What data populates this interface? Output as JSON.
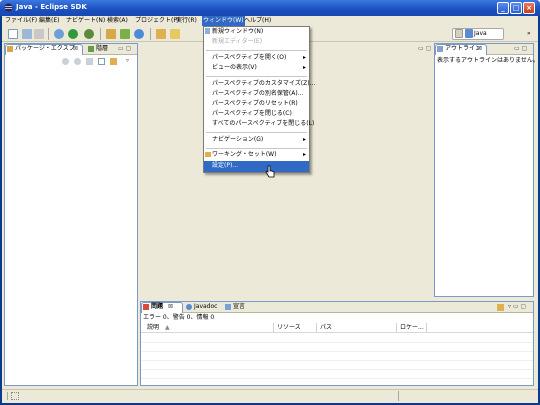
{
  "window": {
    "title": "Java - Eclipse SDK",
    "colors": {
      "titlebar": "#1a4fbf",
      "menu_highlight": "#316ac5",
      "chrome": "#ece9d8",
      "panel_border": "#7a9ac9"
    }
  },
  "menubar": {
    "items": [
      "ファイル(F)",
      "編集(E)",
      "ナビゲート(N)",
      "検索(A)",
      "プロジェクト(P)",
      "実行(R)",
      "ウィンドウ(W)",
      "ヘルプ(H)"
    ],
    "active": "ウィンドウ(W)"
  },
  "toolbar": {
    "perspective_label": "Java",
    "overflow": "»"
  },
  "left_panel": {
    "tab_active": "パッケージ・エクスプ",
    "tab_close": "⊠",
    "tab_other": "階層",
    "window_controls": "▭ ▢"
  },
  "editor_controls": "▭ ▢",
  "outline": {
    "tab": "アウトライン",
    "tab_close": "⊠",
    "message": "表示するアウトラインはありません。",
    "window_controls": "▭ ▢"
  },
  "bottom_panel": {
    "tabs": [
      "問題",
      "Javadoc",
      "宣言"
    ],
    "tab_close": "⊠",
    "summary": "エラー 0、警告 0、情報 0",
    "columns": [
      "説明",
      "リソース",
      "パス",
      "ロケー..."
    ],
    "sort_indicator": "▲",
    "window_controls": "▿ ▭ ▢"
  },
  "window_menu": {
    "items": [
      {
        "label": "新規ウィンドウ(N)",
        "disabled": false,
        "submenu": false
      },
      {
        "label": "新規エディター(E)",
        "disabled": true,
        "submenu": false
      },
      {
        "label": "パースペクティブを開く(O)",
        "disabled": false,
        "submenu": true
      },
      {
        "label": "ビューの表示(V)",
        "disabled": false,
        "submenu": true
      },
      {
        "label": "パースペクティブのカスタマイズ(Z)...",
        "disabled": false,
        "submenu": false
      },
      {
        "label": "パースペクティブの別名保管(A)...",
        "disabled": false,
        "submenu": false
      },
      {
        "label": "パースペクティブのリセット(R)",
        "disabled": false,
        "submenu": false
      },
      {
        "label": "パースペクティブを閉じる(C)",
        "disabled": false,
        "submenu": false
      },
      {
        "label": "すべてのパースペクティブを閉じる(L)",
        "disabled": false,
        "submenu": false
      },
      {
        "label": "ナビゲーション(G)",
        "disabled": false,
        "submenu": true
      },
      {
        "label": "ワーキング・セット(W)",
        "disabled": false,
        "submenu": true
      },
      {
        "label": "設定(P)...",
        "disabled": false,
        "submenu": false,
        "highlighted": true
      }
    ],
    "arrow": "▸"
  },
  "statusbar": {
    "left_icon": "new-item-icon"
  }
}
